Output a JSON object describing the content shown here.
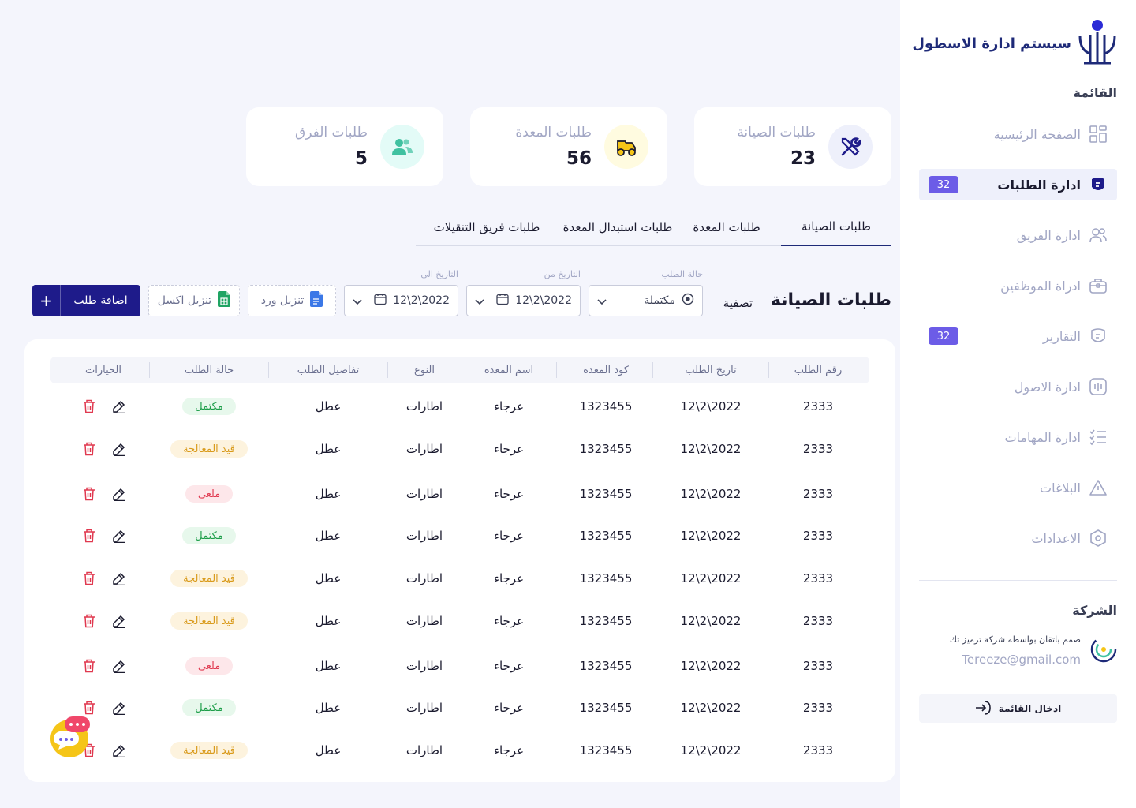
{
  "sidebar": {
    "brand_title": "سيستم ادارة الاسطول",
    "menu_heading": "القائمة",
    "items": [
      {
        "label": "الصفحة الرئيسية",
        "icon": "dashboard-icon"
      },
      {
        "label": "ادارة الطلبات",
        "icon": "requests-icon",
        "badge": "32",
        "active": true
      },
      {
        "label": "ادارة الفريق",
        "icon": "team-icon"
      },
      {
        "label": "ادراة الموظفين",
        "icon": "briefcase-icon"
      },
      {
        "label": "التقارير",
        "icon": "reports-icon",
        "badge": "32"
      },
      {
        "label": "ادارة الاصول",
        "icon": "assets-icon"
      },
      {
        "label": "ادارة المهامات",
        "icon": "tasks-icon"
      },
      {
        "label": "البلاغات",
        "icon": "warning-icon"
      },
      {
        "label": "الاعدادات",
        "icon": "settings-icon"
      }
    ],
    "company_heading": "الشركة",
    "company_credit": "صمم باتقان بواسطه شركة ترميز تك",
    "company_email": "Tereeze@gmail.com",
    "login_label": "ادخال القائمة"
  },
  "stats": [
    {
      "label": "طلبات الصيانة",
      "value": "23",
      "icon": "tools-icon",
      "color": "#eef0fb"
    },
    {
      "label": "طلبات المعدة",
      "value": "56",
      "icon": "tractor-icon",
      "color": "#fffbe0"
    },
    {
      "label": "طلبات الفرق",
      "value": "5",
      "icon": "users-icon",
      "color": "#e3fbf7"
    }
  ],
  "tabs": [
    {
      "label": "طلبات الصيانة",
      "active": true
    },
    {
      "label": "طلبات المعدة"
    },
    {
      "label": "طلبات استبدال المعدة"
    },
    {
      "label": "طلبات فريق التنقيلات"
    }
  ],
  "filters": {
    "section_title": "طلبات الصيانة",
    "filter_label": "تصفية",
    "status_caption": "حالة الطلب",
    "status_value": "مكتملة",
    "from_caption": "التاريخ من",
    "from_value": "12\\2\\2022",
    "to_caption": "التاريخ الى",
    "to_value": "12\\2\\2022",
    "word_label": "تنزيل ورد",
    "excel_label": "تنزيل اكسل",
    "add_label": "اضافة طلب",
    "add_symbol": "+"
  },
  "table": {
    "headers": [
      "رقم الطلب",
      "تاريخ الطلب",
      "كود المعدة",
      "اسم المعدة",
      "النوع",
      "تفاصيل الطلب",
      "حالة الطلب",
      "الخيارات"
    ],
    "rows": [
      {
        "id": "2333",
        "date": "12\\2\\2022",
        "code": "1323455",
        "name": "عرجاء",
        "type": "اطارات",
        "details": "عطل",
        "status": "مكتمل",
        "status_kind": "done"
      },
      {
        "id": "2333",
        "date": "12\\2\\2022",
        "code": "1323455",
        "name": "عرجاء",
        "type": "اطارات",
        "details": "عطل",
        "status": "قيد المعالجة",
        "status_kind": "progress"
      },
      {
        "id": "2333",
        "date": "12\\2\\2022",
        "code": "1323455",
        "name": "عرجاء",
        "type": "اطارات",
        "details": "عطل",
        "status": "ملغى",
        "status_kind": "cancel"
      },
      {
        "id": "2333",
        "date": "12\\2\\2022",
        "code": "1323455",
        "name": "عرجاء",
        "type": "اطارات",
        "details": "عطل",
        "status": "مكتمل",
        "status_kind": "done"
      },
      {
        "id": "2333",
        "date": "12\\2\\2022",
        "code": "1323455",
        "name": "عرجاء",
        "type": "اطارات",
        "details": "عطل",
        "status": "قيد المعالجة",
        "status_kind": "progress"
      },
      {
        "id": "2333",
        "date": "12\\2\\2022",
        "code": "1323455",
        "name": "عرجاء",
        "type": "اطارات",
        "details": "عطل",
        "status": "قيد المعالجة",
        "status_kind": "progress"
      },
      {
        "id": "2333",
        "date": "12\\2\\2022",
        "code": "1323455",
        "name": "عرجاء",
        "type": "اطارات",
        "details": "عطل",
        "status": "ملغى",
        "status_kind": "cancel"
      },
      {
        "id": "2333",
        "date": "12\\2\\2022",
        "code": "1323455",
        "name": "عرجاء",
        "type": "اطارات",
        "details": "عطل",
        "status": "مكتمل",
        "status_kind": "done"
      },
      {
        "id": "2333",
        "date": "12\\2\\2022",
        "code": "1323455",
        "name": "عرجاء",
        "type": "اطارات",
        "details": "عطل",
        "status": "قيد المعالجة",
        "status_kind": "progress"
      }
    ]
  },
  "colors": {
    "accent": "#1e1b8a",
    "brand": "#1e2a78",
    "badge": "#6c5ce7",
    "delete": "#e0384f"
  }
}
